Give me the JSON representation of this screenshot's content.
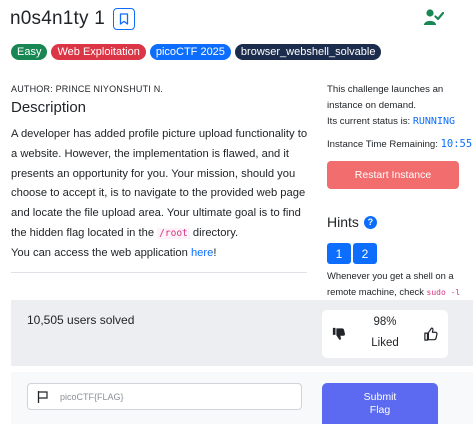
{
  "challenge": {
    "title": "n0s4n1ty 1",
    "tags": [
      "Easy",
      "Web Exploitation",
      "picoCTF 2025",
      "browser_webshell_solvable"
    ],
    "author": "AUTHOR: PRINCE NIYONSHUTI N.",
    "description_heading": "Description",
    "description_part1": "A developer has added profile picture upload functionality to a website. However, the implementation is flawed, and it presents an opportunity for you. Your mission, should you choose to accept it, is to navigate to the provided web page and locate the file upload area. Your ultimate goal is to find the hidden flag located in the ",
    "description_code": "/root",
    "description_part2": " directory.",
    "access_prefix": "You can access the web application ",
    "access_link": "here",
    "access_suffix": "!"
  },
  "instance": {
    "launch_text": "This challenge launches an instance on demand.",
    "status_label": "Its current status is:",
    "status_value": "RUNNING",
    "time_label": "Instance Time Remaining:",
    "time_value": "10:55",
    "restart_label": "Restart Instance"
  },
  "hints": {
    "title": "Hints",
    "help_glyph": "?",
    "buttons": [
      "1",
      "2"
    ],
    "text_prefix": "Whenever you get a shell on a remote machine, check",
    "text_code": "sudo -l"
  },
  "stats": {
    "users_solved": "10,505 users solved",
    "liked_percent": "98%",
    "liked_label": "Liked"
  },
  "flag": {
    "placeholder": "picoCTF{FLAG}",
    "submit_line1": "Submit",
    "submit_line2": "Flag"
  },
  "colors": {
    "primary": "#0d6efd",
    "easy_tag": "#198754",
    "web_tag": "#dc3545",
    "browser_tag": "#1c2c4c",
    "restart": "#f26d6d",
    "submit": "#5b6af0",
    "solved_check": "#198754"
  },
  "icons": {
    "bookmark": "bookmark-icon",
    "solved": "user-check-icon",
    "thumb_down": "thumbs-down-icon",
    "thumb_up": "thumbs-up-icon",
    "flag": "flag-icon",
    "help": "question-circle-icon"
  }
}
